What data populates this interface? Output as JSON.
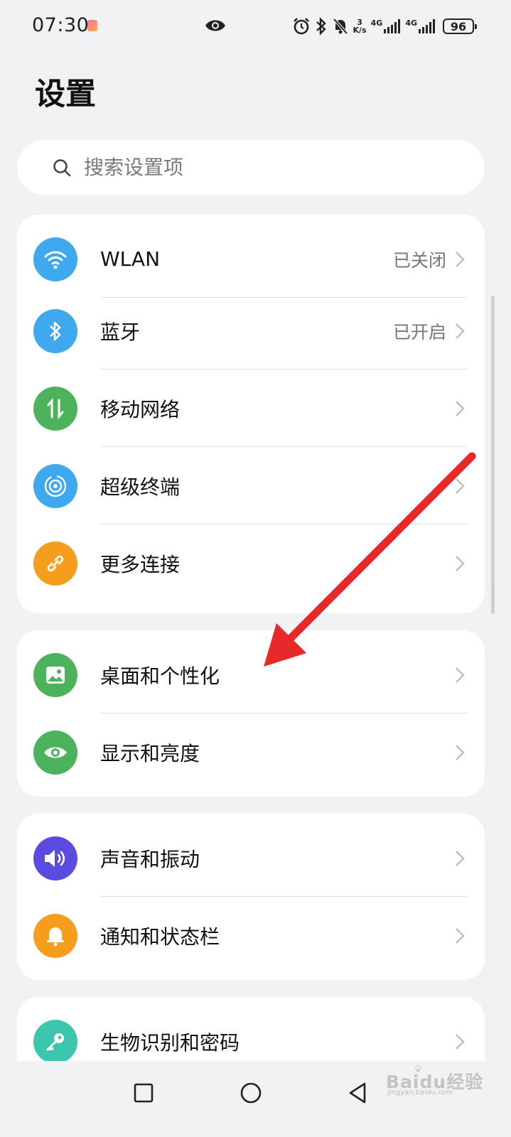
{
  "status_bar": {
    "time": "07:30",
    "speed_top": "3",
    "speed_bottom": "K/s",
    "net1": "4G",
    "net2": "4G",
    "battery": "96",
    "icons": [
      "eye-icon",
      "alarm-icon",
      "bluetooth-icon",
      "mute-icon",
      "signal-icon",
      "battery-icon"
    ]
  },
  "page": {
    "title": "设置"
  },
  "search": {
    "placeholder": "搜索设置项"
  },
  "sections": [
    {
      "items": [
        {
          "label": "WLAN",
          "value": "已关闭",
          "icon": "wifi-icon",
          "color": "#3fa9f0"
        },
        {
          "label": "蓝牙",
          "value": "已开启",
          "icon": "bluetooth-icon",
          "color": "#3fa9f0"
        },
        {
          "label": "移动网络",
          "value": "",
          "icon": "mobile-data-icon",
          "color": "#4cb35c"
        },
        {
          "label": "超级终端",
          "value": "",
          "icon": "super-device-icon",
          "color": "#3fa9f0"
        },
        {
          "label": "更多连接",
          "value": "",
          "icon": "link-icon",
          "color": "#f59d1d"
        }
      ]
    },
    {
      "items": [
        {
          "label": "桌面和个性化",
          "icon": "wallpaper-icon",
          "color": "#4cb35c"
        },
        {
          "label": "显示和亮度",
          "icon": "eye-icon",
          "color": "#4cb35c"
        }
      ]
    },
    {
      "items": [
        {
          "label": "声音和振动",
          "icon": "speaker-icon",
          "color": "#5b4ce0"
        },
        {
          "label": "通知和状态栏",
          "icon": "bell-icon",
          "color": "#f59d1d"
        }
      ]
    },
    {
      "items": [
        {
          "label": "生物识别和密码",
          "icon": "key-icon",
          "color": "#3cc6ad"
        }
      ]
    }
  ],
  "nav": {
    "icons": [
      "recent-apps-icon",
      "home-icon",
      "back-icon"
    ]
  },
  "watermark": {
    "brand": "Baidu经验",
    "sub": "jingyan.baidu.com"
  },
  "colors": {
    "background": "#f1f2f4",
    "card": "#ffffff",
    "annotation_arrow": "#e8292a"
  }
}
